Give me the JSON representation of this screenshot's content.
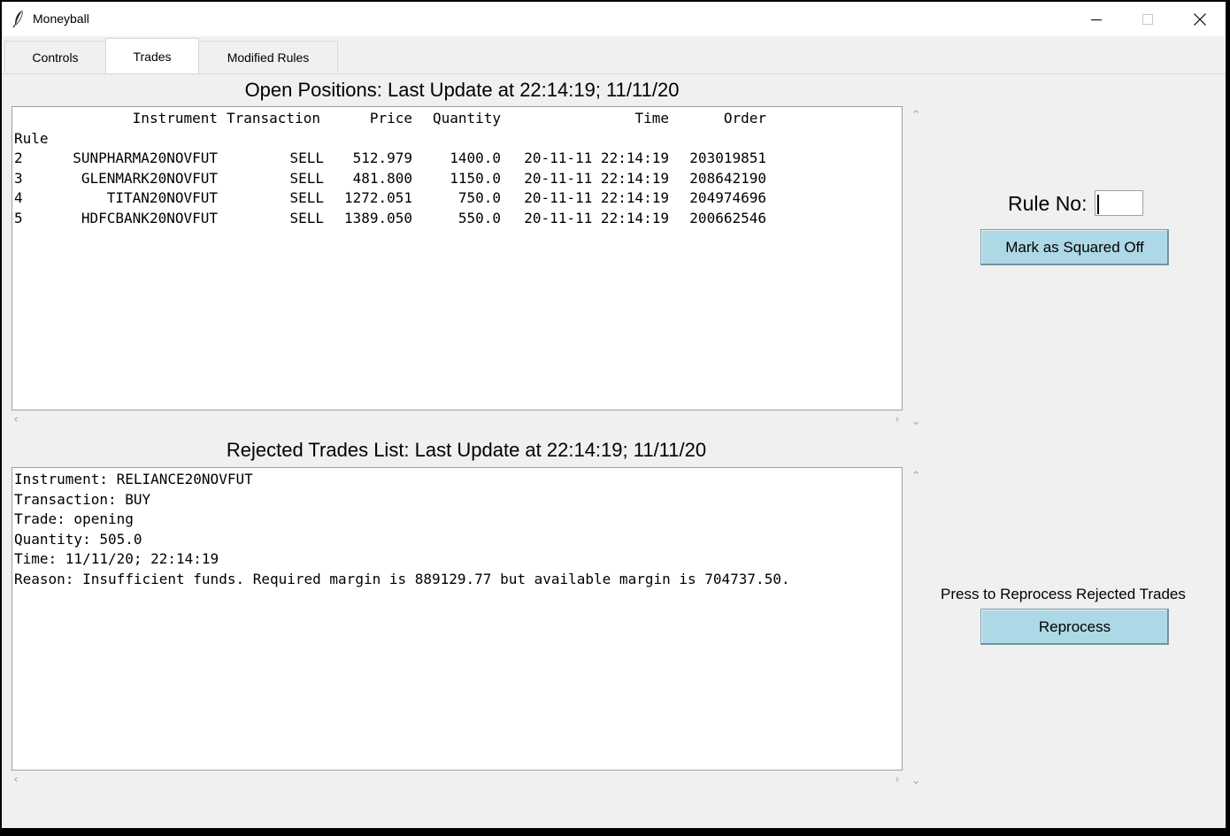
{
  "window": {
    "title": "Moneyball"
  },
  "tabs": [
    {
      "label": "Controls",
      "active": false
    },
    {
      "label": "Trades",
      "active": true
    },
    {
      "label": "Modified Rules",
      "active": false
    }
  ],
  "open_positions": {
    "heading": "Open Positions: Last Update at 22:14:19; 11/11/20",
    "columns": [
      "Instrument",
      "Transaction",
      "Price",
      "Quantity",
      "Time",
      "Order"
    ],
    "index_label": "Rule",
    "rows": [
      {
        "rule": "2",
        "instrument": "SUNPHARMA20NOVFUT",
        "transaction": "SELL",
        "price": "512.979",
        "quantity": "1400.0",
        "time": "20-11-11 22:14:19",
        "order": "203019851"
      },
      {
        "rule": "3",
        "instrument": "GLENMARK20NOVFUT",
        "transaction": "SELL",
        "price": "481.800",
        "quantity": "1150.0",
        "time": "20-11-11 22:14:19",
        "order": "208642190"
      },
      {
        "rule": "4",
        "instrument": "TITAN20NOVFUT",
        "transaction": "SELL",
        "price": "1272.051",
        "quantity": "750.0",
        "time": "20-11-11 22:14:19",
        "order": "204974696"
      },
      {
        "rule": "5",
        "instrument": "HDFCBANK20NOVFUT",
        "transaction": "SELL",
        "price": "1389.050",
        "quantity": "550.0",
        "time": "20-11-11 22:14:19",
        "order": "200662546"
      }
    ]
  },
  "rejected_trades": {
    "heading": "Rejected Trades List: Last Update at 22:14:19; 11/11/20",
    "lines": [
      "Instrument: RELIANCE20NOVFUT",
      "Transaction: BUY",
      "Trade: opening",
      "Quantity: 505.0",
      "Time: 11/11/20; 22:14:19",
      "Reason: Insufficient funds. Required margin is 889129.77 but available margin is 704737.50."
    ]
  },
  "side_panel": {
    "rule_no_label": "Rule No:",
    "rule_no_value": "",
    "mark_squared_off_label": "Mark as Squared Off",
    "reprocess_prompt": "Press to Reprocess Rejected Trades",
    "reprocess_label": "Reprocess",
    "button_color": "#add8e6"
  },
  "icons": {
    "app": "feather-icon",
    "minimize": "minimize-icon",
    "maximize": "maximize-icon",
    "close": "close-icon"
  }
}
